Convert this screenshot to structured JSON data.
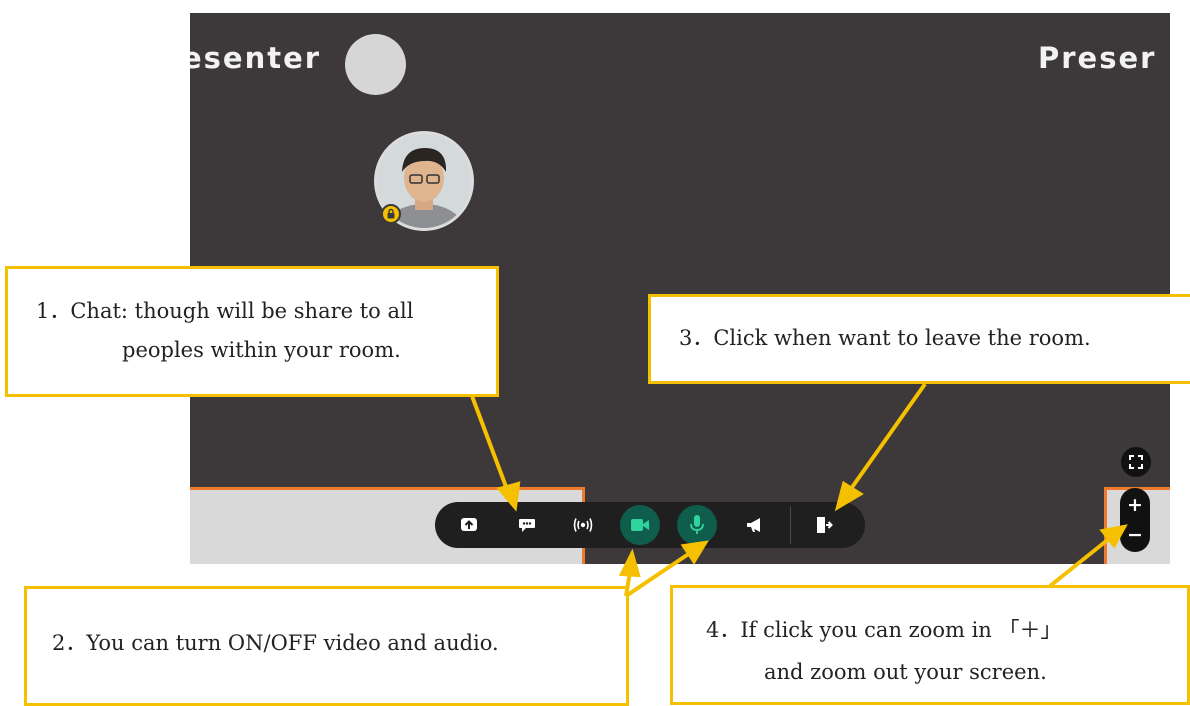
{
  "room": {
    "presenter_left": "esenter",
    "presenter_right": "Preser"
  },
  "toolbar": {
    "buttons": [
      {
        "name": "share-screen-icon"
      },
      {
        "name": "chat-icon"
      },
      {
        "name": "broadcast-icon"
      },
      {
        "name": "video-camera-icon"
      },
      {
        "name": "microphone-icon"
      },
      {
        "name": "megaphone-icon"
      },
      {
        "name": "leave-door-icon"
      }
    ],
    "accent_color": "#0f5d4d"
  },
  "zoom": {
    "in_label": "+",
    "out_label": "−"
  },
  "callouts": {
    "chat": {
      "line1": "1．Chat: though will be share to all",
      "line2": "peoples within your room."
    },
    "video_audio": {
      "line1": "2．You can turn ON/OFF video and audio."
    },
    "leave": {
      "line1": "3．Click when want to leave the room."
    },
    "zoom": {
      "line1": "4．If click you can zoom in 「＋」",
      "line2": "and zoom out your screen."
    },
    "border_color": "#f5c000"
  }
}
